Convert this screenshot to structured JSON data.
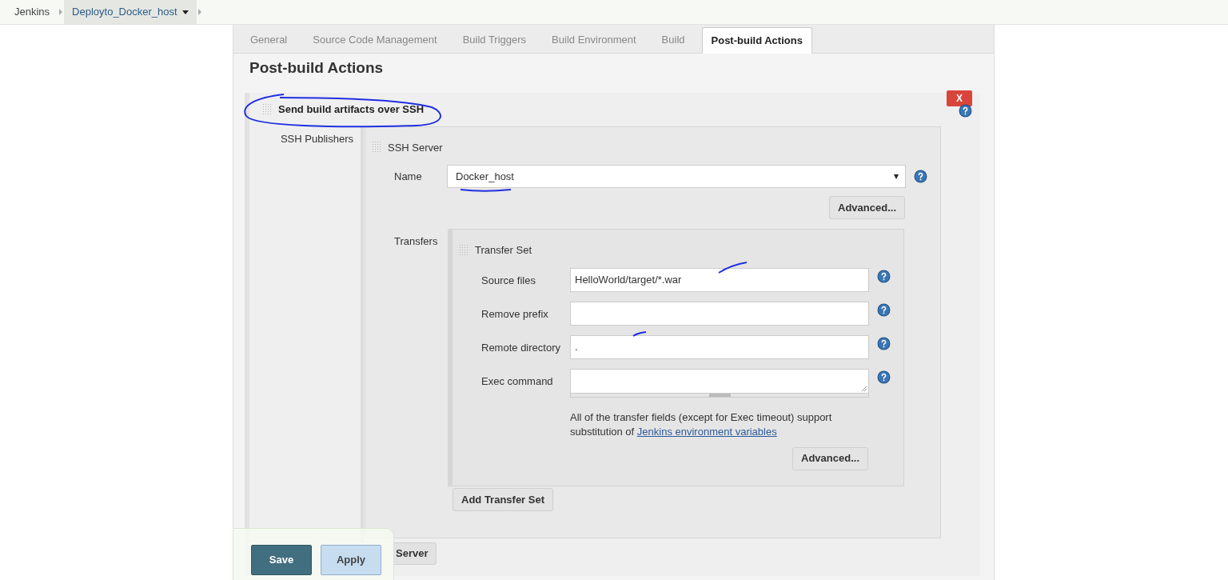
{
  "breadcrumbs": [
    {
      "label": "Jenkins",
      "selected": false,
      "has_menu": false
    },
    {
      "label": "Deployto_Docker_host",
      "selected": true,
      "has_menu": true
    }
  ],
  "tabs": [
    {
      "label": "General",
      "selected": false
    },
    {
      "label": "Source Code Management",
      "selected": false
    },
    {
      "label": "Build Triggers",
      "selected": false
    },
    {
      "label": "Build Environment",
      "selected": false
    },
    {
      "label": "Build",
      "selected": false
    },
    {
      "label": "Post-build Actions",
      "selected": true
    }
  ],
  "section_title": "Post-build Actions",
  "publisher": {
    "title": "Send build artifacts over SSH",
    "delete_button": "X",
    "label": "SSH Publishers",
    "server": {
      "title": "SSH Server",
      "name_label": "Name",
      "name_value": "Docker_host",
      "advanced_button": "Advanced...",
      "transfers_label": "Transfers",
      "transfer_set": {
        "title": "Transfer Set",
        "fields": [
          {
            "kind": "input",
            "label": "Source files",
            "value": "HelloWorld/target/*.war"
          },
          {
            "kind": "input",
            "label": "Remove prefix"
          },
          {
            "kind": "input",
            "label": "Remote directory",
            "value": "."
          },
          {
            "kind": "textarea",
            "label": "Exec command"
          }
        ],
        "help_text": "All of the transfer fields (except for Exec timeout) support substitution of ",
        "help_link": "Jenkins environment variables",
        "advanced_button": "Advanced..."
      },
      "add_transfer_button": "Add Transfer Set"
    },
    "add_server_button": "Server"
  },
  "footer": {
    "buttons": [
      {
        "label": "Save",
        "kind": "primary"
      },
      {
        "label": "Apply",
        "kind": "secondary"
      }
    ]
  }
}
